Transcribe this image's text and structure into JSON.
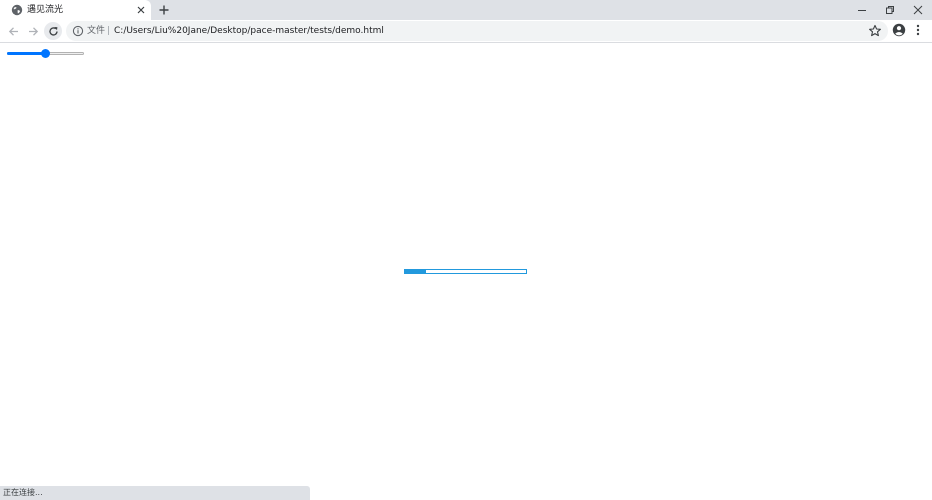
{
  "tab": {
    "title": "遇见流光",
    "favicon": "globe-icon",
    "close_icon": "close-icon"
  },
  "new_tab_icon": "plus-icon",
  "window_controls": {
    "minimize_icon": "minimize-icon",
    "restore_icon": "restore-icon",
    "close_icon": "close-icon"
  },
  "toolbar": {
    "back_icon": "arrow-left-icon",
    "forward_icon": "arrow-right-icon",
    "reload_icon": "reload-icon",
    "site_info_icon": "info-icon",
    "file_label": "文件",
    "separator": "|",
    "url": "C:/Users/Liu%20Jane/Desktop/pace-master/tests/demo.html",
    "bookmark_icon": "star-icon",
    "profile_icon": "account-icon",
    "menu_icon": "more-vertical-icon"
  },
  "page": {
    "range_slider_value": 0.5,
    "pace_progress": 0.17
  },
  "status": {
    "text": "正在连接..."
  },
  "colors": {
    "tabstrip_bg": "#dee1e6",
    "omnibox_bg": "#f1f3f4",
    "slider_accent": "#0075ff",
    "pace_accent": "#2299dd"
  }
}
